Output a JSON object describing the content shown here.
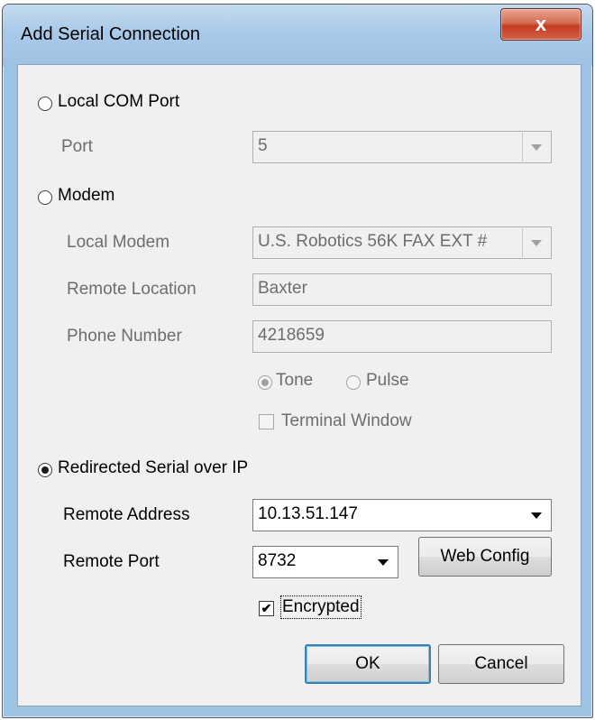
{
  "window": {
    "title": "Add Serial Connection",
    "close_glyph": "x"
  },
  "local_com": {
    "label": "Local COM Port",
    "port_label": "Port",
    "port_value": "5"
  },
  "modem": {
    "label": "Modem",
    "local_modem_label": "Local Modem",
    "local_modem_value": "U.S. Robotics 56K FAX EXT #",
    "remote_location_label": "Remote Location",
    "remote_location_value": "Baxter",
    "phone_label": "Phone Number",
    "phone_value": "4218659",
    "tone_label": "Tone",
    "pulse_label": "Pulse",
    "terminal_label": "Terminal Window"
  },
  "redirected": {
    "label": "Redirected Serial over IP",
    "remote_address_label": "Remote Address",
    "remote_address_value": "10.13.51.147",
    "remote_port_label": "Remote Port",
    "remote_port_value": "8732",
    "web_config_label": "Web Config",
    "encrypted_label": "Encrypted"
  },
  "buttons": {
    "ok": "OK",
    "cancel": "Cancel"
  },
  "state": {
    "selected_connection": "Redirected Serial over IP",
    "dial_mode": "Tone",
    "terminal_window_checked": false,
    "encrypted_checked": true
  },
  "icons": {
    "close": "close-icon",
    "dropdown": "chevron-down-icon",
    "check": "checkmark-icon"
  }
}
